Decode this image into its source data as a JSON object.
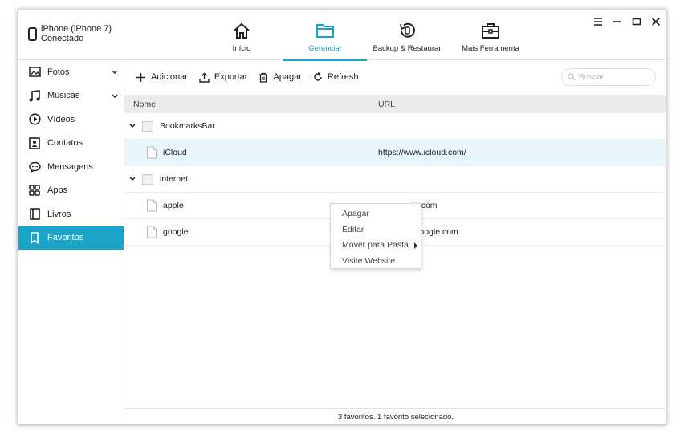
{
  "device": {
    "line1": "iPhone (iPhone 7)",
    "line2": "Conectado"
  },
  "nav": [
    {
      "label": "Início",
      "icon": "home-icon"
    },
    {
      "label": "Gerenciar",
      "icon": "folder-icon",
      "active": true
    },
    {
      "label": "Backup & Restaurar",
      "icon": "backup-restore-icon"
    },
    {
      "label": "Mais Ferramenta",
      "icon": "toolbox-icon"
    }
  ],
  "window_controls": [
    "menu-icon",
    "minimize-icon",
    "maximize-icon",
    "close-icon"
  ],
  "sidebar": {
    "items": [
      {
        "label": "Fotos",
        "icon": "photos-icon",
        "expandable": true
      },
      {
        "label": "Músicas",
        "icon": "music-icon",
        "expandable": true
      },
      {
        "label": "Vídeos",
        "icon": "video-icon"
      },
      {
        "label": "Contatos",
        "icon": "contacts-icon"
      },
      {
        "label": "Mensagens",
        "icon": "messages-icon"
      },
      {
        "label": "Apps",
        "icon": "apps-icon"
      },
      {
        "label": "Livros",
        "icon": "books-icon"
      },
      {
        "label": "Favoritos",
        "icon": "bookmark-icon",
        "active": true
      }
    ]
  },
  "toolbar": {
    "add": "Adicionar",
    "export": "Exportar",
    "delete": "Apagar",
    "refresh": "Refresh",
    "search_placeholder": "Buscar"
  },
  "table": {
    "headers": {
      "name": "Nome",
      "url": "URL"
    },
    "rows": [
      {
        "type": "folder",
        "name": "BookmarksBar",
        "url": ""
      },
      {
        "type": "file",
        "name": "iCloud",
        "url": "https://www.icloud.com/",
        "selected": true
      },
      {
        "type": "folder",
        "name": "internet",
        "url": ""
      },
      {
        "type": "file",
        "name": "apple",
        "url": "www.apple.com"
      },
      {
        "type": "file",
        "name": "google",
        "url": "http:www.google.com"
      }
    ]
  },
  "context_menu": {
    "items": [
      "Apagar",
      "Editar",
      "Mover para Pasta",
      "Visite Website"
    ]
  },
  "status": "3 favoritos. 1 favorito selecionado.",
  "colors": {
    "accent": "#1aa5c8",
    "selected_row": "#e8f5fa",
    "header_bg": "#ebebeb"
  }
}
